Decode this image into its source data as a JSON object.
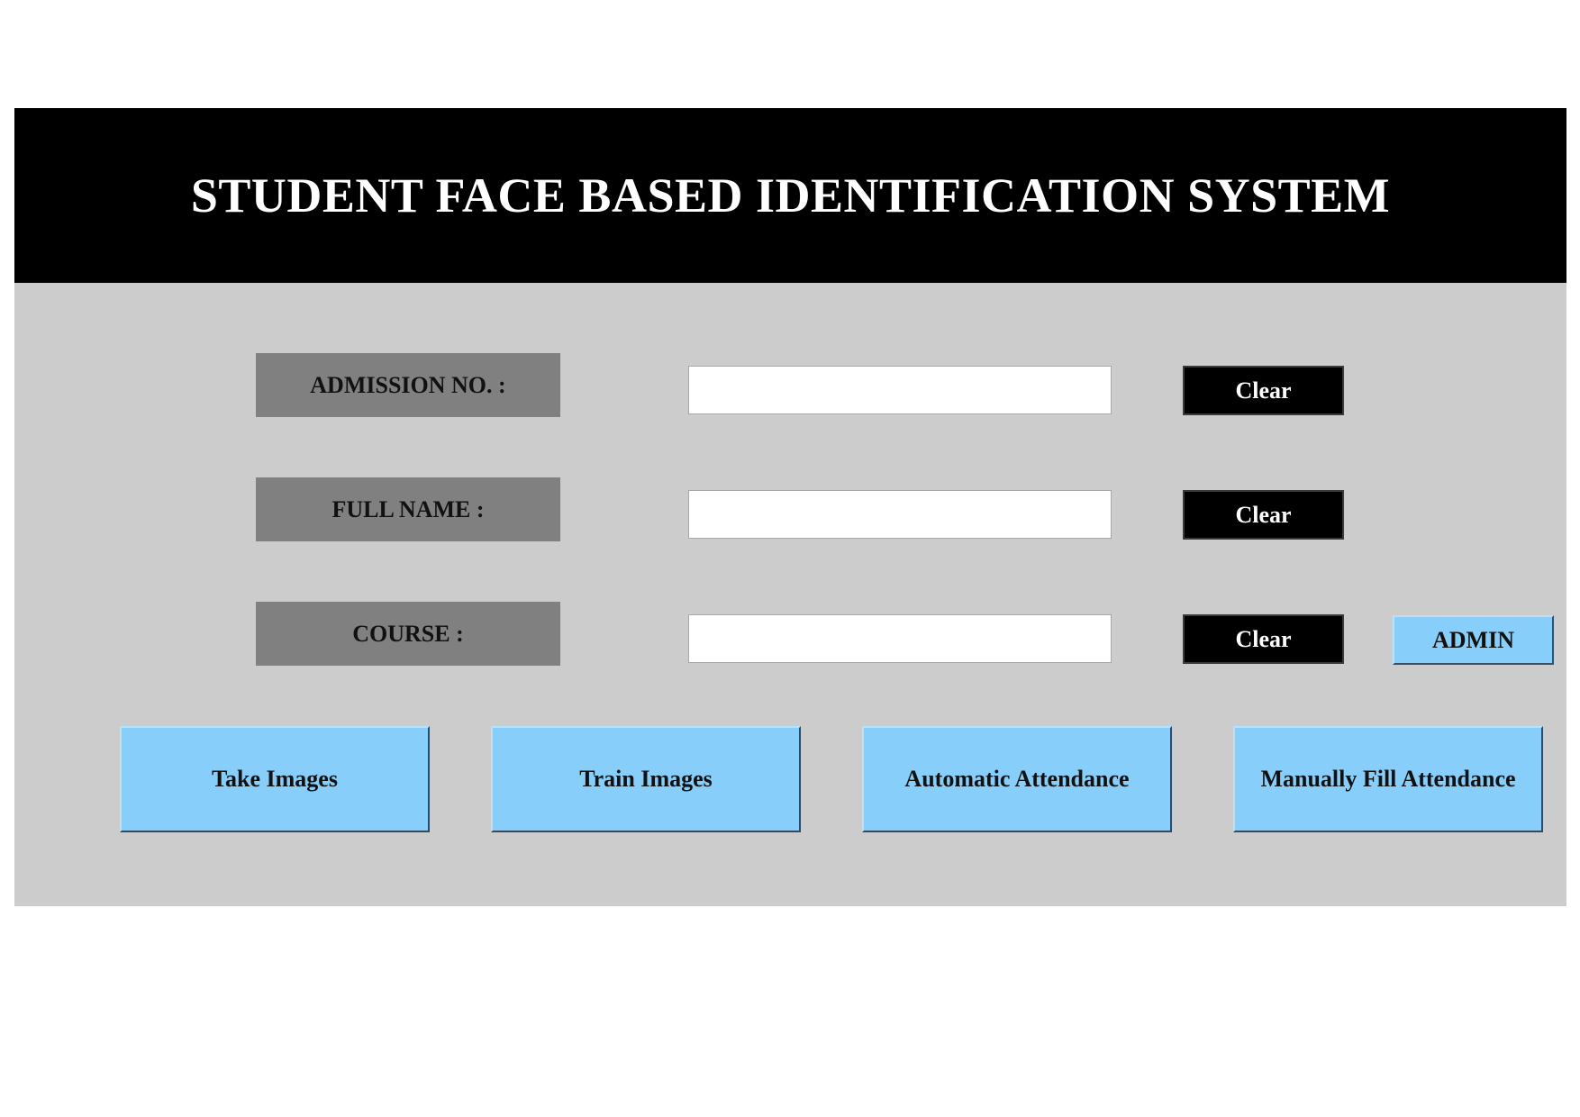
{
  "header": {
    "title": "STUDENT FACE BASED IDENTIFICATION SYSTEM"
  },
  "form": {
    "admission": {
      "label": "ADMISSION NO. :",
      "value": "",
      "clear_label": "Clear"
    },
    "full_name": {
      "label": "FULL NAME :",
      "value": "",
      "clear_label": "Clear"
    },
    "course": {
      "label": "COURSE :",
      "value": "",
      "clear_label": "Clear"
    }
  },
  "admin_button": {
    "label": "ADMIN"
  },
  "actions": {
    "take_images": "Take Images",
    "train_images": "Train Images",
    "automatic_attendance": "Automatic Attendance",
    "manually_fill_attendance": "Manually Fill Attendance"
  },
  "colors": {
    "header_bg": "#000000",
    "panel_bg": "#cccccc",
    "label_bg": "#808080",
    "accent_button": "#87cefa",
    "clear_button": "#000000"
  }
}
